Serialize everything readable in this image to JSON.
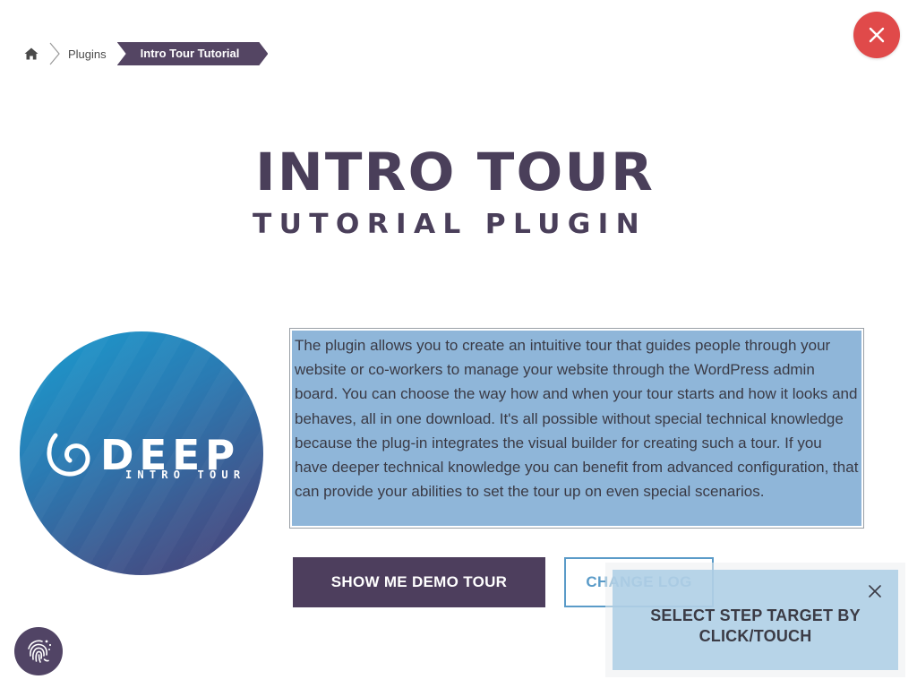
{
  "breadcrumb": {
    "home_icon": "home-icon",
    "items": [
      {
        "label": "Plugins"
      },
      {
        "label": "Intro Tour Tutorial"
      }
    ]
  },
  "close_icon": "close-icon",
  "title": {
    "line1": "INTRO TOUR",
    "line2": "TUTORIAL PLUGIN"
  },
  "logo": {
    "wordmark": "DEEP",
    "subtitle": "INTRO TOUR"
  },
  "description": "The plugin allows you to create an intuitive tour that guides people through your website or co-workers to manage your website through the WordPress admin board. You can choose the way how and when your tour starts and how it looks and behaves, all in one download. It's all possible without special technical knowledge because the plug-in integrates the visual builder for creating such a tour. If you have deeper technical knowledge you can benefit from advanced configuration, that can provide your abilities to set the tour up on even special scenarios.",
  "buttons": {
    "demo": "SHOW ME DEMO TOUR",
    "changelog": "CHANGE LOG"
  },
  "step_tooltip": {
    "text_line1": "SELECT STEP TARGET BY",
    "text_line2": "CLICK/TOUCH"
  },
  "colors": {
    "accent": "#544563",
    "close": "#e04a4a",
    "link_blue": "#5a9bc8",
    "highlight": "#8fb6d9"
  }
}
